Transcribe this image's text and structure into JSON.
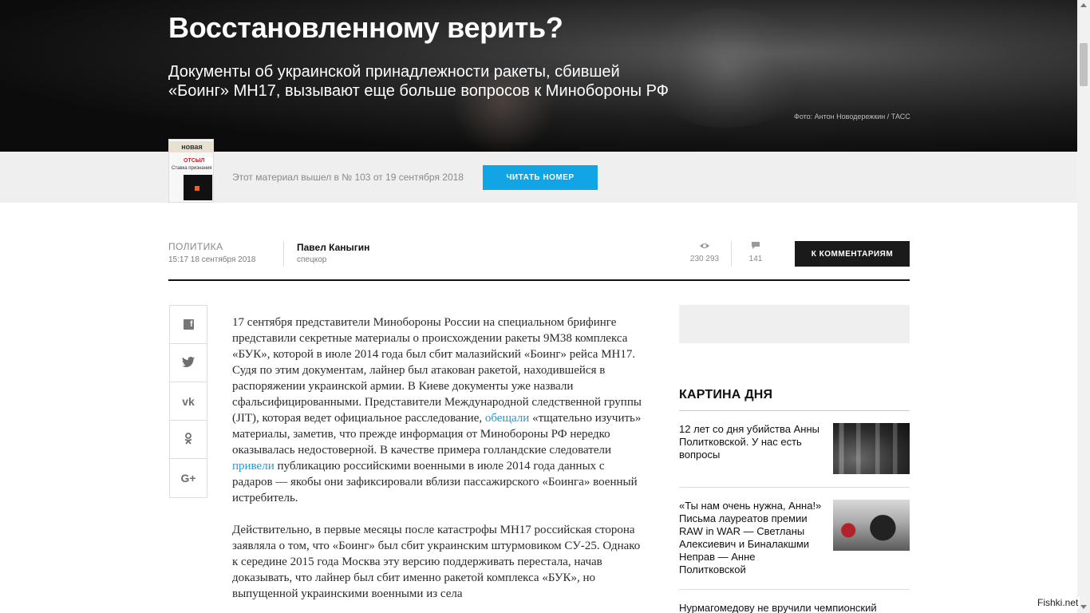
{
  "hero": {
    "title": "Восстановленному верить?",
    "lead": "Документы об украинской принадлежности ракеты, сбившей «Боинг» MH17, вызывают еще больше вопросов к Минобороны РФ",
    "photo_credit": "Фото: Антон Новодережкин / ТАСС"
  },
  "issue": {
    "cover_masthead": "новая",
    "cover_headline": "ОТСЫЛ",
    "cover_sub": "Ставка признания",
    "text": "Этот материал вышел в № 103 от 19 сентября 2018",
    "read_button": "ЧИТАТЬ НОМЕР"
  },
  "meta": {
    "rubric": "ПОЛИТИКА",
    "date": "15:17 18 сентября 2018",
    "author_name": "Павел Каныгин",
    "author_role": "спецкор",
    "views_icon": "eye-icon",
    "views": "230 293",
    "comments_icon": "comment-icon",
    "comments": "141",
    "to_comments_button": "К КОММЕНТАРИЯМ"
  },
  "share": [
    {
      "name": "facebook",
      "glyph": "f"
    },
    {
      "name": "twitter",
      "glyph": "🐦"
    },
    {
      "name": "vk",
      "glyph": "vk"
    },
    {
      "name": "odnoklassniki",
      "glyph": "ок"
    },
    {
      "name": "google-plus",
      "glyph": "G+"
    }
  ],
  "article": {
    "p1_a": "17 сентября представители Минобороны России на специальном брифинге представили секретные материалы о происхождении ракеты 9М38 комплекса «БУК», которой в июле 2014 года был сбит малазийский «Боинг» рейса МН17. Судя по этим документам, лайнер был атакован ракетой, находившейся в распоряжении украинской армии. В Киеве документы уже назвали сфальсифицированными. Представители Международной следственной группы (JIT), которая ведет официальное расследование, ",
    "p1_link1": "обещали",
    "p1_b": " «тщательно изучить» материалы, заметив, что прежде информация от Минобороны РФ нередко оказывалась недостоверной. В качестве примера голландские следователи ",
    "p1_link2": "привели",
    "p1_c": " публикацию российскими военными в июле 2014 года данных с радаров — якобы они зафиксировали вблизи пассажирского «Боинга» военный истребитель.",
    "p2": "Действительно, в первые месяцы после катастрофы МН17 российская сторона заявляла о том, что «Боинг» был сбит украинским штурмовиком СУ-25. Однако к середине 2015 года Москва эту версию поддерживать перестала, начав доказывать, что лайнер был сбит именно ракетой комплекса «БУК», но выпущенной украинскими военными из села"
  },
  "sidebar": {
    "section_title": "КАРТИНА ДНЯ",
    "items": [
      {
        "title": "12 лет со дня убийства Анны Политковской. У нас есть вопросы"
      },
      {
        "title": "«Ты нам очень нужна, Анна!» Письма лауреатов премии RAW in WAR — Светланы Алексиевич и Биналакшми Неправ — Анне Политковской"
      },
      {
        "title": "Нурмагомедову не вручили чемпионский"
      }
    ]
  },
  "watermark": "Fishki.net"
}
